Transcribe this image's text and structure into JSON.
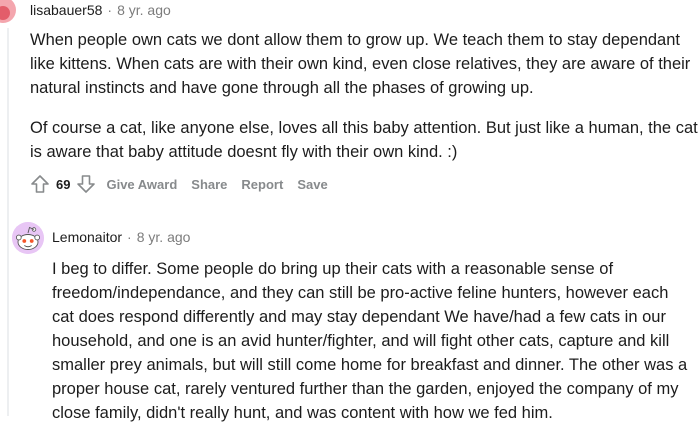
{
  "comment1": {
    "username": "lisabauer58",
    "separator": "·",
    "age": "8 yr. ago",
    "paragraphs": [
      "When people own cats we dont allow them to grow up. We teach them to stay dependant like kittens. When cats are with their own kind, even close relatives, they are aware of their natural instincts and have gone through all the phases of growing up.",
      "Of course a cat, like anyone else, loves all this baby attention. But just like a human, the cat is aware that baby attitude doesnt fly with their own kind. :)"
    ],
    "score": "69",
    "actions": {
      "give_award": "Give Award",
      "share": "Share",
      "report": "Report",
      "save": "Save"
    }
  },
  "comment2": {
    "username": "Lemonaitor",
    "separator": "·",
    "age": "8 yr. ago",
    "paragraphs": [
      "I beg to differ. Some people do bring up their cats with a reasonable sense of freedom/independance, and they can still be pro-active feline hunters, however each cat does respond differently and may stay dependant We have/had a few cats in our household, and one is an avid hunter/fighter, and will fight other cats, capture and kill smaller prey animals, but will still come home for breakfast and dinner. The other was a proper house cat, rarely ventured further than the garden, enjoyed the company of my close family, didn't really hunt, and was content with how we fed him."
    ]
  },
  "icons": {
    "upvote": "upvote-arrow-icon",
    "downvote": "downvote-arrow-icon",
    "avatar2": "snoo-avatar-icon"
  },
  "colors": {
    "meta_gray": "#7c7c7c",
    "action_gray": "#878a8c",
    "avatar2_bg": "#e8c6f5",
    "avatar1_bg": "#f4a6ae"
  }
}
